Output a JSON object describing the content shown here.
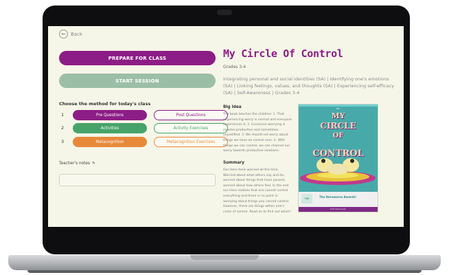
{
  "nav": {
    "back_label": "Back"
  },
  "actions": {
    "prepare_label": "PREPARE FOR CLASS",
    "start_label": "START SESSION"
  },
  "methods": {
    "heading": "Choose the method for today's class",
    "rows": [
      {
        "num": "1",
        "primary": "Pre Questions",
        "secondary": "Post Questions",
        "color": "#8d1d86"
      },
      {
        "num": "2",
        "primary": "Activities",
        "secondary": "Activity Exercises",
        "color": "#47a36a"
      },
      {
        "num": "3",
        "primary": "Metacognition",
        "secondary": "Metacognition Exercises",
        "color": "#e8893a"
      }
    ]
  },
  "notes": {
    "label": "Teacher's notes",
    "placeholder": ""
  },
  "lesson": {
    "title": "My Circle Of Control",
    "grades": "Grades 3-4",
    "tags": "Integrating personal and social identities (SA) | Identifying one's emotions (SA) | Linking feelings, values, and thoughts (SA) | Experiencing self-efficacy (SA) | Self-Awareness | Grades 3-4",
    "big_idea_title": "Big Idea",
    "big_idea_text": "The book teaches the children: 1. That experiencing worry is normal and everyone experiences it. 2. Excessive worrying is counter-productive and sometimes unjustified. 3. We should not worry about things we have no control over. 4. With things we can control, we can channel our worry towards productive solutions.",
    "summary_title": "Summary",
    "summary_text": "Our Hero feels worried all the time. Worried about what others say and do, worried about things that have passed, worried about how others feel. In the end our Hero realizes that one cannot control everything and there is no point in worrying about things you cannot control. However, there are things within one's circle of control. Read on to find out which!"
  },
  "cover": {
    "subtitle": "SEL",
    "title_line1": "MY",
    "title_line2": "CIRCLE",
    "title_line3": "OF",
    "title_line4": "CONTROL",
    "logo_text": "HW",
    "series": "The Herowarve Awards!",
    "footer": "Self Awareness"
  }
}
